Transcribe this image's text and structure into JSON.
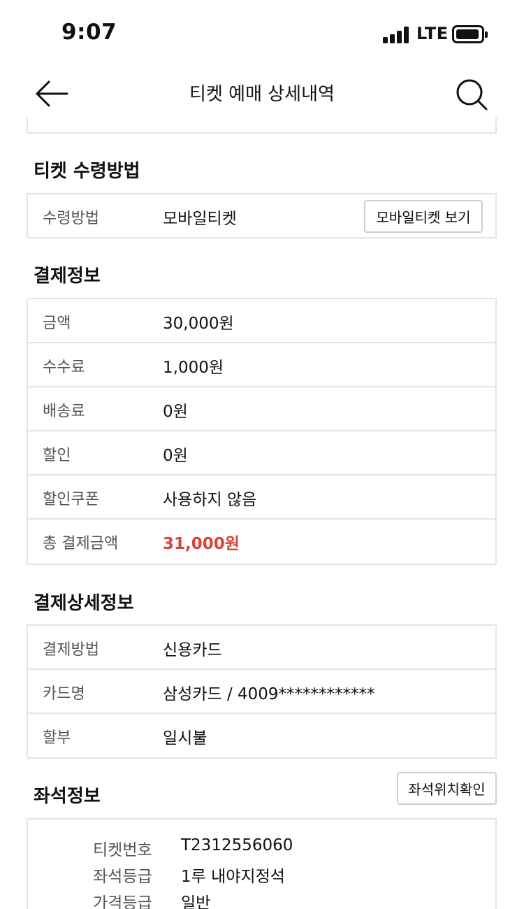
{
  "status_bar": {
    "time": "9:07",
    "network": "LTE"
  },
  "header": {
    "title": "티켓 예매 상세내역"
  },
  "receive": {
    "title": "티켓 수령방법",
    "label": "수령방법",
    "value": "모바일티켓",
    "button": "모바일티켓 보기"
  },
  "payment": {
    "title": "결제정보",
    "rows": [
      {
        "label": "금액",
        "value": "30,000원"
      },
      {
        "label": "수수료",
        "value": "1,000원"
      },
      {
        "label": "배송료",
        "value": "0원"
      },
      {
        "label": "할인",
        "value": "0원"
      },
      {
        "label": "할인쿠폰",
        "value": "사용하지 않음"
      },
      {
        "label": "총 결제금액",
        "value": "31,000원"
      }
    ],
    "total_color": "#d8433a"
  },
  "payment_detail": {
    "title": "결제상세정보",
    "rows": [
      {
        "label": "결제방법",
        "value": "신용카드"
      },
      {
        "label": "카드명",
        "value": "삼성카드 / 4009************"
      },
      {
        "label": "할부",
        "value": "일시불"
      }
    ]
  },
  "seat": {
    "title": "좌석정보",
    "button": "좌석위치확인",
    "rows": [
      {
        "label": "티켓번호",
        "value": "T2312556060"
      },
      {
        "label": "좌석등급",
        "value": "1루 내야지정석"
      },
      {
        "label": "가격등급",
        "value": "일반"
      }
    ]
  }
}
